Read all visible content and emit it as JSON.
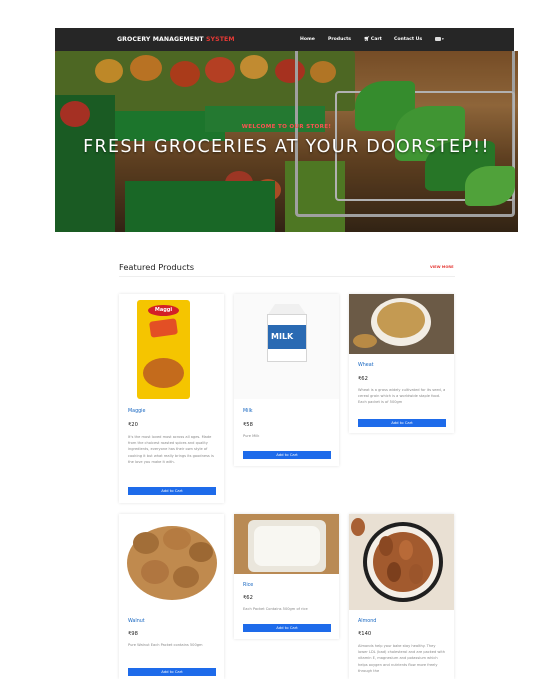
{
  "navbar": {
    "brand_main": "GROCERY MANAGEMENT",
    "brand_accent": "SYSTEM",
    "links": {
      "home": "Home",
      "products": "Products",
      "cart": "Cart",
      "contact": "Contact Us"
    },
    "cart_icon": "shopping-cart-icon",
    "user_icon": "user-card-icon",
    "caret": "▾"
  },
  "hero": {
    "subtitle": "WELCOME TO OUR STORE!",
    "title": "FRESH GROCERIES AT YOUR DOORSTEP!!"
  },
  "featured": {
    "title": "Featured Products",
    "view_more": "VIEW MORE"
  },
  "products": [
    {
      "name": "Maggie",
      "price": "₹20",
      "description": "It's the most loved most across all ages. Made from the choicest roasted spices and quality ingredients, everyone has their own style of cooking it but what really brings its goodness is the love you make it with.",
      "button": "Add to Cart"
    },
    {
      "name": "Milk",
      "price": "₹58",
      "description": "Pure Milk",
      "button": "Add to Cart"
    },
    {
      "name": "Wheat",
      "price": "₹62",
      "description": "Wheat is a grass widely cultivated for its seed, a cereal grain which is a worldwide staple food. Each packet is of 500gm",
      "button": "Add to Cart"
    },
    {
      "name": "Walnut",
      "price": "₹98",
      "description": "Pure Walnut Each Packet contains 500gm",
      "button": "Add to Cart"
    },
    {
      "name": "Rice",
      "price": "₹62",
      "description": "Each Packet Contains 500gm of rice",
      "button": "Add to Cart"
    },
    {
      "name": "Almond",
      "price": "₹140",
      "description": "Almonds help your bake stay healthy. They lower LDL (bad) cholesterol and are packed with vitamin E, magnesium and potassium which helps oxygen and nutrients flow more freely through the",
      "button": ""
    }
  ],
  "colors": {
    "navbar_bg": "#262626",
    "accent_red": "#e53935",
    "button_blue": "#1e6bea",
    "product_name_blue": "#1565c0"
  }
}
